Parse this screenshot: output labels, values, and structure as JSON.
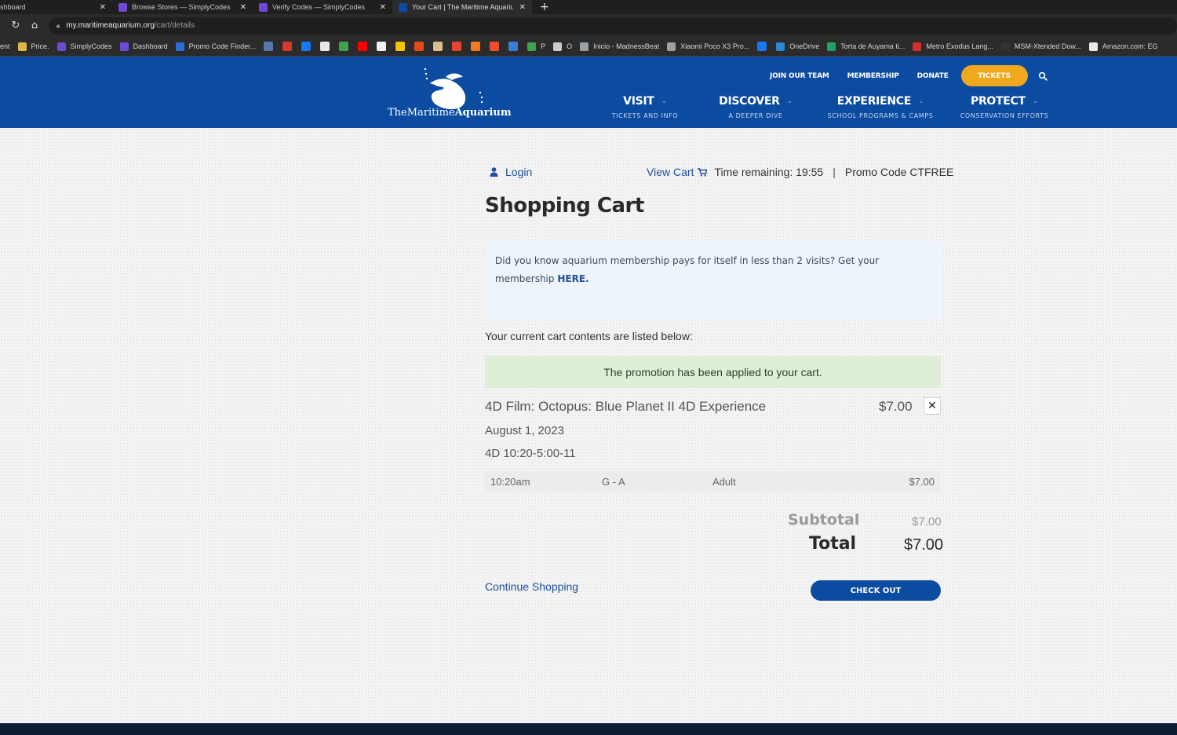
{
  "browser": {
    "tabs": [
      {
        "label": "shboard",
        "color": "#2b5fb8"
      },
      {
        "label": "Browse Stores — SimplyCodes",
        "color": "#6c4ad6"
      },
      {
        "label": "Verify Codes — SimplyCodes",
        "color": "#6c4ad6"
      },
      {
        "label": "Your Cart | The Maritime Aquariu",
        "color": "#0b4ba0"
      }
    ],
    "new_tab": "+",
    "url_host": "my.maritimeaquarium.org",
    "url_path": "/cart/details",
    "bookmarks": [
      {
        "label": "ent",
        "color": "#777777"
      },
      {
        "label": "Price.",
        "color": "#e0b54a"
      },
      {
        "label": "SimplyCodes",
        "color": "#6c4ad6"
      },
      {
        "label": "Dashboard",
        "color": "#6c4ad6"
      },
      {
        "label": "Promo Code Finder...",
        "color": "#2b6fd6"
      },
      {
        "label": "",
        "color": "#5577aa"
      },
      {
        "label": "",
        "color": "#d23b2b"
      },
      {
        "label": "",
        "color": "#1877f2"
      },
      {
        "label": "",
        "color": "#e8e8e8"
      },
      {
        "label": "",
        "color": "#3fa34d"
      },
      {
        "label": "",
        "color": "#ff0000"
      },
      {
        "label": "",
        "color": "#f0f0f0"
      },
      {
        "label": "",
        "color": "#f5c400"
      },
      {
        "label": "",
        "color": "#e64a19"
      },
      {
        "label": "",
        "color": "#d9c08a"
      },
      {
        "label": "",
        "color": "#ea4335"
      },
      {
        "label": "",
        "color": "#f07b20"
      },
      {
        "label": "",
        "color": "#ee4d2d"
      },
      {
        "label": "",
        "color": "#3b7dd8"
      },
      {
        "label": "P",
        "color": "#3fa34d"
      },
      {
        "label": "O",
        "color": "#cccccc"
      },
      {
        "label": "Inicio - MadnessBeat",
        "color": "#9aa0a6"
      },
      {
        "label": "Xiaomi Poco X3 Pro...",
        "color": "#9aa0a6"
      },
      {
        "label": "",
        "color": "#1877f2"
      },
      {
        "label": "OneDrive",
        "color": "#2b88d8"
      },
      {
        "label": "Torta de Auyama ti...",
        "color": "#21a366"
      },
      {
        "label": "Metro Exodus Lang...",
        "color": "#d32f2f"
      },
      {
        "label": "MSM-Xtended Dow...",
        "color": "#333333"
      },
      {
        "label": "Amazon.com: EG",
        "color": "#e8e8e8"
      }
    ]
  },
  "site": {
    "logo": {
      "text_the": "The",
      "text_maritime": "Maritime",
      "text_aquarium": "Aquarium"
    },
    "util_nav": [
      "JOIN OUR TEAM",
      "MEMBERSHIP",
      "DONATE"
    ],
    "tickets_label": "TICKETS",
    "main_nav": [
      {
        "title": "VISIT",
        "sub": "TICKETS AND INFO"
      },
      {
        "title": "DISCOVER",
        "sub": "A DEEPER DIVE"
      },
      {
        "title": "EXPERIENCE",
        "sub": "SCHOOL PROGRAMS & CAMPS"
      },
      {
        "title": "PROTECT",
        "sub": "CONSERVATION EFFORTS"
      }
    ],
    "brand_color": "#0b4ba0",
    "accent_color": "#f0a81e"
  },
  "cart": {
    "login": "Login",
    "view_cart": "View Cart",
    "time_remaining": "Time remaining: 19:55",
    "separator": "|",
    "promo_code": "Promo Code CTFREE",
    "heading": "Shopping Cart",
    "membership_text": "Did you know aquarium membership pays for itself in less than 2 visits? Get your membership",
    "membership_link": "HERE",
    "membership_period": ".",
    "lead": "Your current cart contents are listed below:",
    "promo_applied": "The promotion has been applied to your cart.",
    "item": {
      "title": "4D Film: Octopus: Blue Planet II 4D Experience",
      "price": "$7.00",
      "remove": "✕",
      "date": "August 1, 2023",
      "session": "4D 10:20-5:00-11",
      "line": {
        "time": "10:20am",
        "section": "G - A",
        "type": "Adult",
        "price": "$7.00"
      }
    },
    "subtotal_label": "Subtotal",
    "subtotal_value": "$7.00",
    "total_label": "Total",
    "total_value": "$7.00",
    "continue": "Continue Shopping",
    "checkout": "CHECK OUT"
  }
}
